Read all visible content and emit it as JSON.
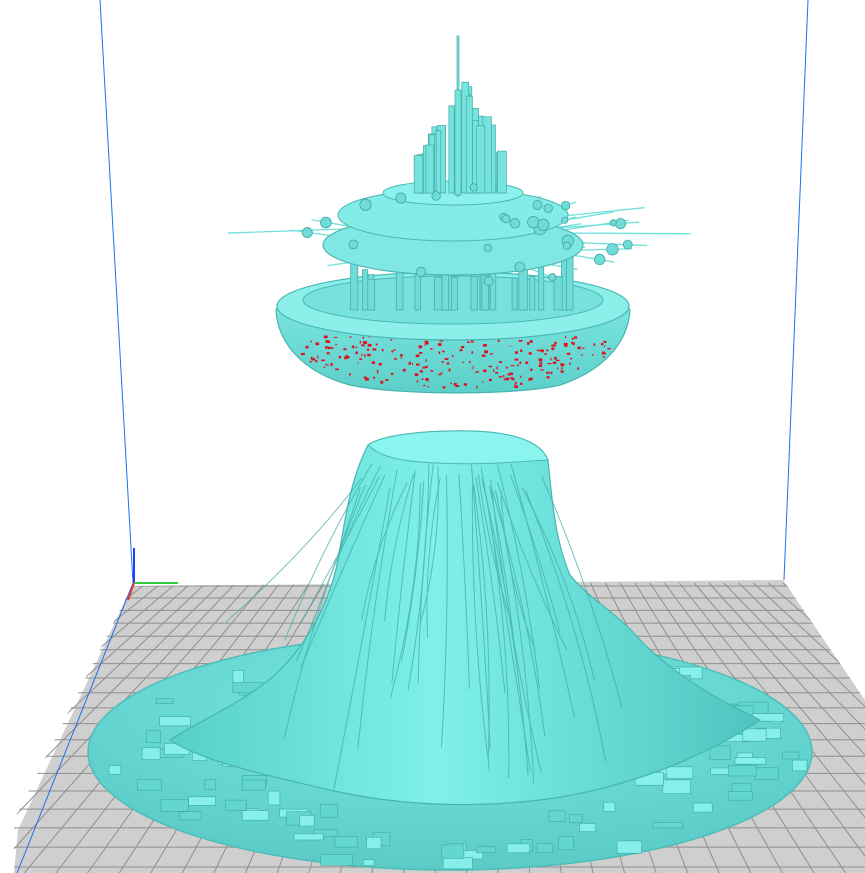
{
  "viewport": {
    "background": "#ffffff",
    "plate_color": "#c8c8c8",
    "grid_color": "#8f8f8f",
    "volume_line_color": "#1a73e8",
    "axis_x_color": "#e53935",
    "axis_y_color": "#2ecc40",
    "axis_z_color": "#1e3fff"
  },
  "models": [
    {
      "name": "floating-city",
      "color": "#7fe0dc",
      "overhang_color": "#e01020"
    },
    {
      "name": "mesa-rock",
      "color": "#6fe0dc"
    }
  ]
}
